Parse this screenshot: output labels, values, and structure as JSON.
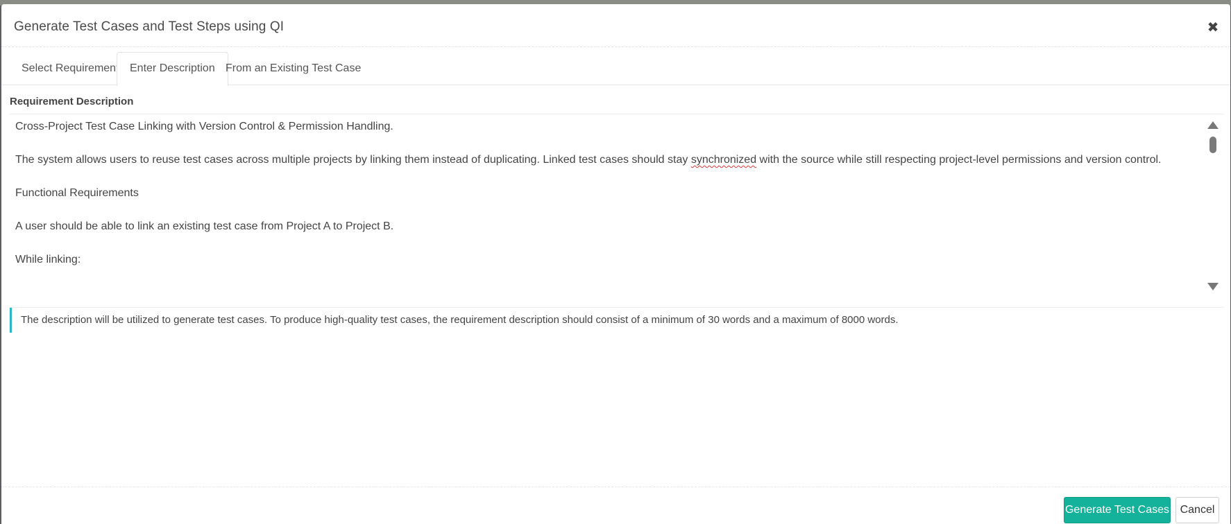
{
  "modal": {
    "title": "Generate Test Cases and Test Steps using QI"
  },
  "icons": {
    "close": "close-icon",
    "scroll_up": "scroll-up-arrow-icon",
    "scroll_down": "scroll-down-arrow-icon"
  },
  "tabs": [
    {
      "label": "Select Requirement",
      "active": false
    },
    {
      "label": "Enter Description",
      "active": true
    },
    {
      "label": "From an Existing Test Case",
      "active": false
    }
  ],
  "description": {
    "label": "Requirement Description",
    "paragraphs": [
      "Cross-Project Test Case Linking with Version Control & Permission Handling.",
      "The system allows users to reuse test cases across multiple projects by linking them instead of duplicating. Linked test cases should stay",
      "synchronized",
      "with the source while still respecting project-level permissions and version control.",
      "Functional Requirements",
      "A user should be able to link an existing test case from Project A to Project B.",
      "While linking:"
    ]
  },
  "info_note": "The description will be utilized to generate test cases. To produce high-quality test cases, the requirement description should consist of a minimum of 30 words and a maximum of 8000 words.",
  "buttons": {
    "generate": "Generate Test Cases",
    "cancel": "Cancel"
  },
  "colors": {
    "accent": "#14b19b",
    "info_border": "#29b6c9"
  }
}
